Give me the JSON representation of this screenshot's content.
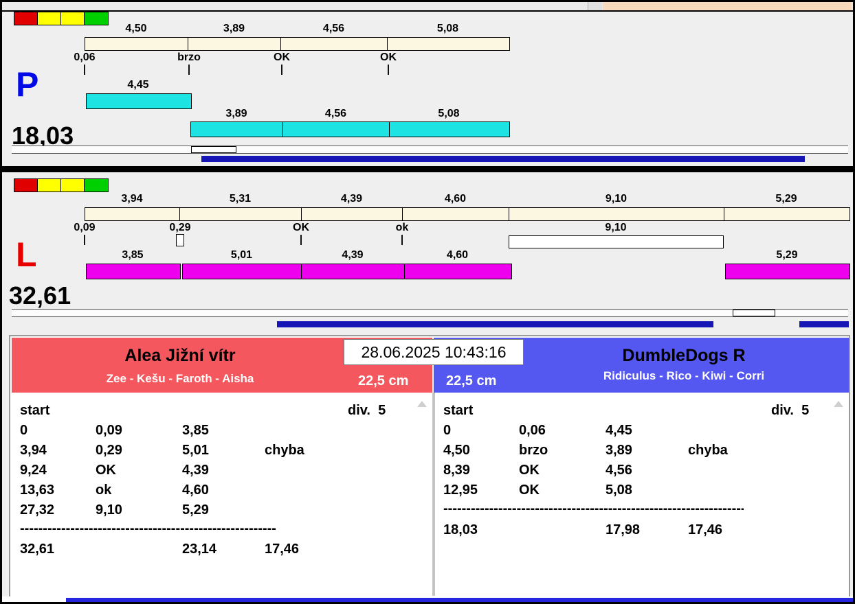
{
  "window": {
    "timestamp": "28.06.2025 10:43:16"
  },
  "colors": {
    "ruler_cream": "#fbf7e1",
    "lane_p_bar": "#1ee3e3",
    "lane_l_bar": "#ee00ee",
    "progress_blue": "#1616b6",
    "left_header": "#f4585e",
    "right_header": "#5457f0",
    "lane_p_letter": "#0009e6",
    "lane_l_letter": "#e80000",
    "lights": [
      "#e00000",
      "#ffff00",
      "#ffff00",
      "#00cf00"
    ]
  },
  "lane_p": {
    "letter": "P",
    "total": "18,03",
    "ruler": [
      "4,50",
      "3,89",
      "4,56",
      "5,08"
    ],
    "marks": [
      "0,06",
      "brzo",
      "OK",
      "OK"
    ],
    "bar1_label": "4,45",
    "bar2_labels": [
      "3,89",
      "4,56",
      "5,08"
    ]
  },
  "lane_l": {
    "letter": "L",
    "total": "32,61",
    "ruler": [
      "3,94",
      "5,31",
      "4,39",
      "4,60",
      "9,10",
      "5,29"
    ],
    "marks": [
      "0,09",
      "0,29",
      "OK",
      "ok",
      "9,10"
    ],
    "bar1_label": "3,85",
    "bar2_labels": [
      "5,01",
      "4,39",
      "4,60"
    ],
    "bar3_label": "5,29"
  },
  "left_team": {
    "name": "Alea Jižní vítr",
    "dogs": "Zee - Kešu - Faroth - Aisha",
    "category": "22,5 cm",
    "table": {
      "start": "start",
      "division": "div.  5",
      "rows": [
        [
          "0",
          "0,09",
          "3,85",
          ""
        ],
        [
          "3,94",
          "0,29",
          "5,01",
          "chyba"
        ],
        [
          "9,24",
          "OK",
          "4,39",
          ""
        ],
        [
          "13,63",
          "ok",
          "4,60",
          ""
        ],
        [
          "27,32",
          "9,10",
          "5,29",
          ""
        ]
      ],
      "separator": "----------------------------------------------------------------------",
      "total": [
        "32,61",
        "",
        "23,14",
        "17,46"
      ]
    }
  },
  "right_team": {
    "name": "DumbleDogs R",
    "dogs": "Ridiculus - Rico - Kiwi - Corri",
    "category": "22,5 cm",
    "table": {
      "start": "start",
      "division": "div.  5",
      "rows": [
        [
          "0",
          "0,06",
          "4,45",
          ""
        ],
        [
          "4,50",
          "brzo",
          "3,89",
          "chyba"
        ],
        [
          "8,39",
          "OK",
          "4,56",
          ""
        ],
        [
          "12,95",
          "OK",
          "5,08",
          ""
        ]
      ],
      "separator": "----------------------------------------------------------------------",
      "total": [
        "18,03",
        "",
        "17,98",
        "17,46"
      ]
    }
  }
}
